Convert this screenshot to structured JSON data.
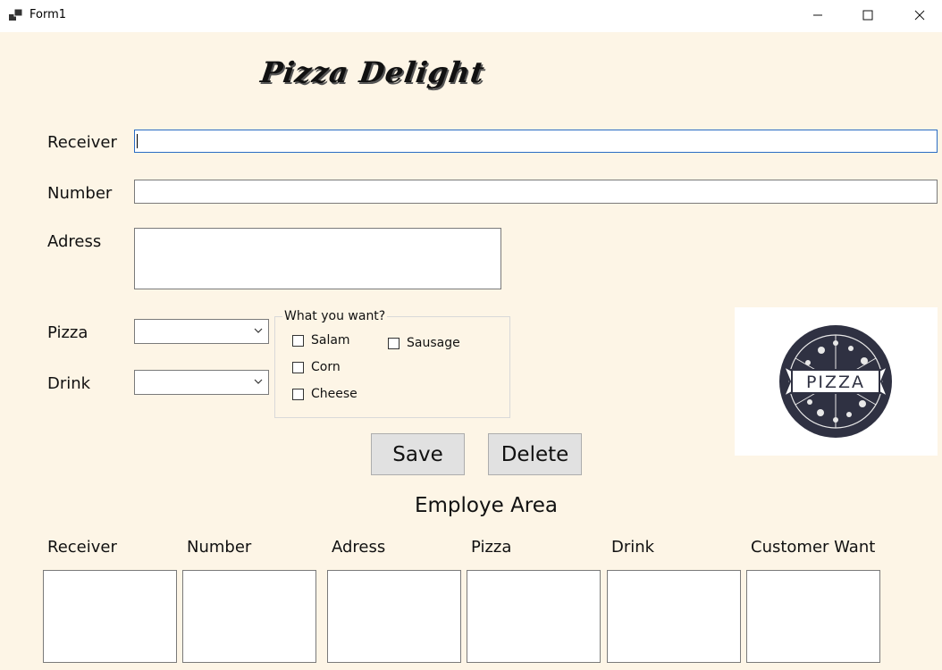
{
  "window": {
    "title": "Form1"
  },
  "brand": "Pizza Delight",
  "form": {
    "receiver_label": "Receiver",
    "receiver_value": "",
    "number_label": "Number",
    "number_value": "",
    "address_label": "Adress",
    "address_value": "",
    "pizza_label": "Pizza",
    "pizza_value": "",
    "drink_label": "Drink",
    "drink_value": ""
  },
  "options": {
    "caption": "What you want?",
    "items": [
      {
        "label": "Salam",
        "checked": false
      },
      {
        "label": "Corn",
        "checked": false
      },
      {
        "label": "Cheese",
        "checked": false
      },
      {
        "label": "Sausage",
        "checked": false
      }
    ]
  },
  "buttons": {
    "save": "Save",
    "delete": "Delete"
  },
  "logo": {
    "text": "PIZZA",
    "icon": "pizza-logo-icon"
  },
  "employee": {
    "title": "Employe Area",
    "columns": [
      "Receiver",
      "Number",
      "Adress",
      "Pizza",
      "Drink",
      "Customer Want"
    ]
  },
  "colors": {
    "background": "#fdf5e6",
    "focus_border": "#2a6cc4",
    "button": "#e1e1e1"
  }
}
